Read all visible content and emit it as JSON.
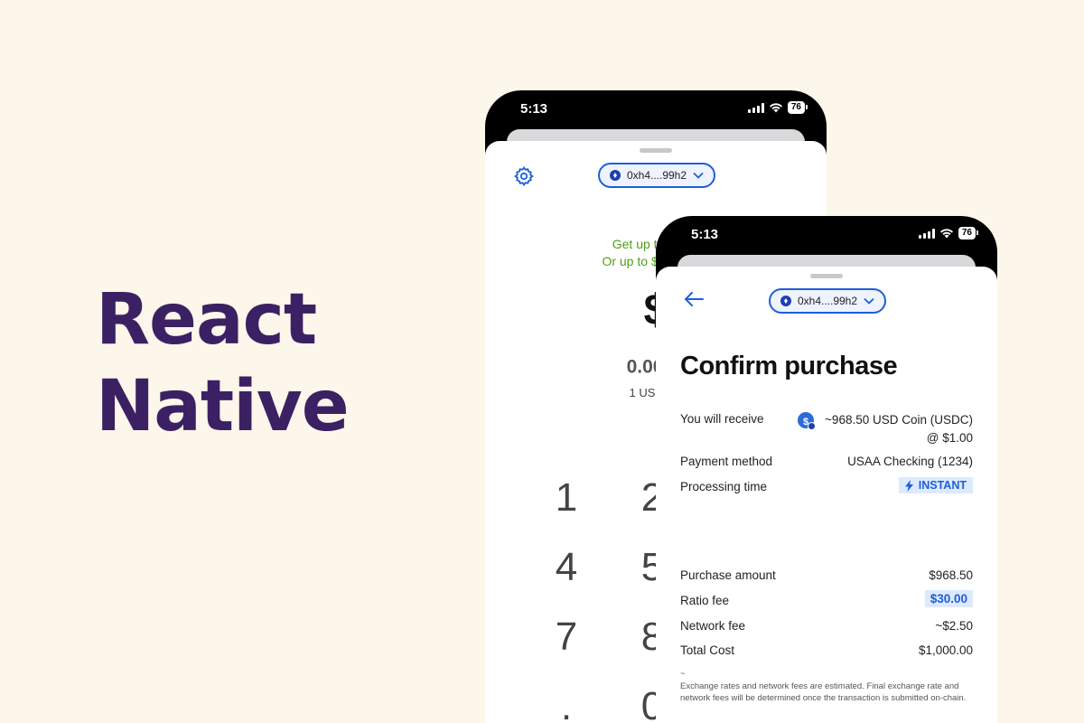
{
  "hero": {
    "line1": "React",
    "line2": "Native"
  },
  "back_phone": {
    "status": {
      "time": "5:13",
      "battery": "76"
    },
    "wallet_address": "0xh4....99h2",
    "promo_line1": "Get up to $5,00",
    "promo_line2": "Or up to $2,000 ins",
    "amount_display": "$",
    "usdc_amount": "0.00",
    "usdc_rate": "1 USDC =",
    "keypad": [
      "1",
      "2",
      "4",
      "5",
      "7",
      "8",
      ".",
      "0"
    ]
  },
  "front_phone": {
    "status": {
      "time": "5:13",
      "battery": "76"
    },
    "wallet_address": "0xh4....99h2",
    "title": "Confirm purchase",
    "receive": {
      "label": "You will receive",
      "value_line1": "~968.50 USD Coin (USDC)",
      "value_line2": "@ $1.00"
    },
    "payment_method": {
      "label": "Payment method",
      "value": "USAA Checking (1234)"
    },
    "processing_time": {
      "label": "Processing time",
      "value": "INSTANT"
    },
    "purchase_amount": {
      "label": "Purchase amount",
      "value": "$968.50"
    },
    "ratio_fee": {
      "label": "Ratio fee",
      "value": "$30.00"
    },
    "network_fee": {
      "label": "Network fee",
      "value": "~$2.50"
    },
    "total_cost": {
      "label": "Total Cost",
      "value": "$1,000.00"
    },
    "disclaimer_tilde": "~",
    "disclaimer": "Exchange rates and network fees are estimated. Final exchange rate and network fees will be determined once the transaction is submitted on-chain."
  },
  "colors": {
    "background": "#fdf6ea",
    "hero_text": "#3b2163",
    "accent": "#1d5fd8",
    "promo_green": "#4f9f17"
  },
  "icons": [
    "gear-icon",
    "chevron-down-icon",
    "back-arrow-icon",
    "lightning-icon",
    "usdc-coin-icon",
    "wifi-icon",
    "signal-icon",
    "battery-icon"
  ]
}
